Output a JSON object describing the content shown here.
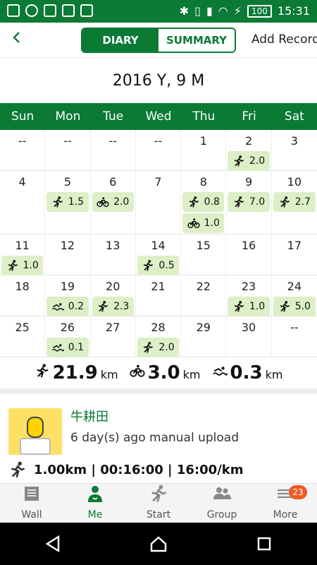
{
  "status_bar": {
    "battery": "100",
    "time": "15:31"
  },
  "header": {
    "back_icon": "chevron-left-icon",
    "tabs": [
      {
        "label": "DIARY",
        "active": true
      },
      {
        "label": "SUMMARY",
        "active": false
      }
    ],
    "add_record": "Add Record"
  },
  "calendar": {
    "title": "2016 Y, 9 M",
    "weekdays": [
      "Sun",
      "Mon",
      "Tue",
      "Wed",
      "Thu",
      "Fri",
      "Sat"
    ],
    "rows": [
      [
        {
          "day": "--"
        },
        {
          "day": "--"
        },
        {
          "day": "--"
        },
        {
          "day": "--"
        },
        {
          "day": "1"
        },
        {
          "day": "2",
          "records": [
            {
              "type": "run",
              "value": "2.0"
            }
          ]
        },
        {
          "day": "3"
        }
      ],
      [
        {
          "day": "4"
        },
        {
          "day": "5",
          "records": [
            {
              "type": "run",
              "value": "1.5"
            }
          ]
        },
        {
          "day": "6",
          "records": [
            {
              "type": "bike",
              "value": "2.0"
            }
          ]
        },
        {
          "day": "7"
        },
        {
          "day": "8",
          "records": [
            {
              "type": "run",
              "value": "0.8"
            },
            {
              "type": "bike",
              "value": "1.0"
            }
          ]
        },
        {
          "day": "9",
          "records": [
            {
              "type": "run",
              "value": "7.0"
            }
          ]
        },
        {
          "day": "10",
          "records": [
            {
              "type": "run",
              "value": "2.7"
            }
          ]
        }
      ],
      [
        {
          "day": "11",
          "records": [
            {
              "type": "run",
              "value": "1.0"
            }
          ]
        },
        {
          "day": "12"
        },
        {
          "day": "13"
        },
        {
          "day": "14",
          "records": [
            {
              "type": "run",
              "value": "0.5"
            }
          ]
        },
        {
          "day": "15"
        },
        {
          "day": "16"
        },
        {
          "day": "17"
        }
      ],
      [
        {
          "day": "18"
        },
        {
          "day": "19",
          "records": [
            {
              "type": "swim",
              "value": "0.2"
            }
          ]
        },
        {
          "day": "20",
          "records": [
            {
              "type": "run",
              "value": "2.3"
            }
          ]
        },
        {
          "day": "21"
        },
        {
          "day": "22"
        },
        {
          "day": "23",
          "records": [
            {
              "type": "run",
              "value": "1.0"
            }
          ]
        },
        {
          "day": "24",
          "records": [
            {
              "type": "run",
              "value": "5.0"
            }
          ]
        }
      ],
      [
        {
          "day": "25"
        },
        {
          "day": "26",
          "records": [
            {
              "type": "swim",
              "value": "0.1"
            }
          ]
        },
        {
          "day": "27"
        },
        {
          "day": "28",
          "records": [
            {
              "type": "run",
              "value": "2.0"
            }
          ]
        },
        {
          "day": "29"
        },
        {
          "day": "30"
        },
        {
          "day": "--"
        }
      ]
    ]
  },
  "totals": [
    {
      "type": "run",
      "value": "21.9",
      "unit": "km"
    },
    {
      "type": "bike",
      "value": "3.0",
      "unit": "km"
    },
    {
      "type": "swim",
      "value": "0.3",
      "unit": "km"
    }
  ],
  "feed": {
    "user_name": "牛耕田",
    "meta": "6 day(s) ago manual upload",
    "stats": "1.00km | 00:16:00 | 16:00/km"
  },
  "bottom_nav": [
    {
      "label": "Wall",
      "icon": "wall-icon",
      "active": false
    },
    {
      "label": "Me",
      "icon": "person-icon",
      "active": true
    },
    {
      "label": "Start",
      "icon": "runner-icon",
      "active": false
    },
    {
      "label": "Group",
      "icon": "group-icon",
      "active": false
    },
    {
      "label": "More",
      "icon": "menu-icon",
      "active": false,
      "badge": "23"
    }
  ],
  "colors": {
    "primary": "#0a7a35",
    "badge_bg": "#dcefc6",
    "notification": "#f05a22"
  }
}
